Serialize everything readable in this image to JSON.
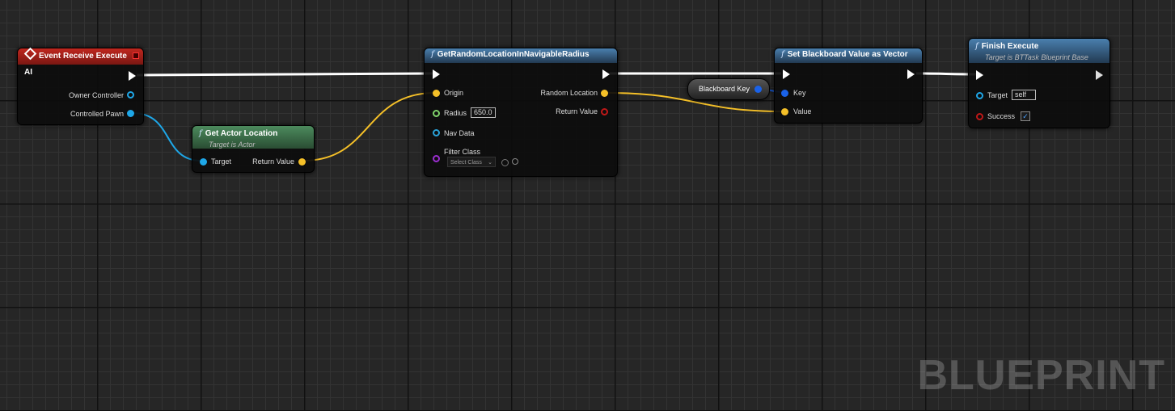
{
  "colors": {
    "event_header": "#b8221b",
    "func_header": "#3c6c97",
    "pure_header": "#3f7a4e",
    "object_pin": "#1ea7e8",
    "vector_pin": "#f5c028",
    "float_pin": "#7fd36b",
    "navdata_pin": "#2aa2d8",
    "class_pin": "#9b2ed0",
    "bool_pin": "#c01818",
    "key_pin": "#1a62e8"
  },
  "event_node": {
    "title": "Event Receive Execute AI",
    "icon": "event-diamond-icon",
    "pins": {
      "owner_controller": "Owner Controller",
      "controlled_pawn": "Controlled Pawn"
    }
  },
  "get_actor_location": {
    "title": "Get Actor Location",
    "subtitle": "Target is Actor",
    "pins": {
      "target": "Target",
      "return_value": "Return Value"
    }
  },
  "random_location": {
    "title": "GetRandomLocationInNavigableRadius",
    "pins": {
      "origin": "Origin",
      "radius": "Radius",
      "radius_value": "650.0",
      "nav_data": "Nav Data",
      "filter_class": "Filter Class",
      "select_class": "Select Class",
      "random_location": "Random Location",
      "return_value": "Return Value"
    }
  },
  "blackboard_key_var": {
    "label": "Blackboard Key"
  },
  "set_bb_vector": {
    "title": "Set Blackboard Value as Vector",
    "pins": {
      "key": "Key",
      "value": "Value"
    }
  },
  "finish_execute": {
    "title": "Finish Execute",
    "subtitle": "Target is BTTask Blueprint Base",
    "pins": {
      "target": "Target",
      "target_value": "self",
      "success": "Success",
      "success_checked": "✓"
    }
  },
  "watermark": "BLUEPRINT"
}
